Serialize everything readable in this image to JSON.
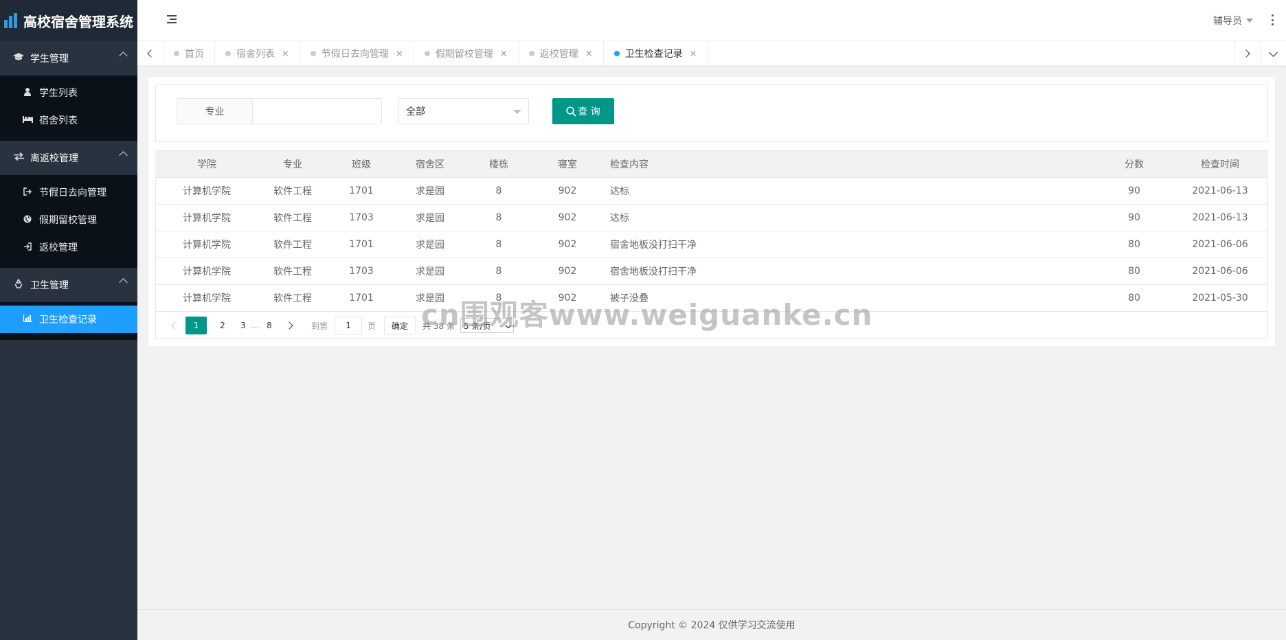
{
  "app": {
    "title": "高校宿舍管理系统"
  },
  "sidebar": {
    "groups": [
      {
        "label": "学生管理",
        "icon": "graduation-cap-icon",
        "items": [
          {
            "label": "学生列表",
            "icon": "user-icon"
          },
          {
            "label": "宿舍列表",
            "icon": "bed-icon"
          }
        ]
      },
      {
        "label": "离返校管理",
        "icon": "exchange-icon",
        "items": [
          {
            "label": "节假日去向管理",
            "icon": "sign-out-icon"
          },
          {
            "label": "假期留校管理",
            "icon": "globe-icon"
          },
          {
            "label": "返校管理",
            "icon": "sign-in-icon"
          }
        ]
      },
      {
        "label": "卫生管理",
        "icon": "recycle-icon",
        "items": [
          {
            "label": "卫生检查记录",
            "icon": "bar-chart-icon",
            "active": true
          }
        ]
      }
    ]
  },
  "header": {
    "user": "辅导员"
  },
  "tabs": [
    {
      "label": "首页",
      "closable": false,
      "active": false
    },
    {
      "label": "宿舍列表",
      "closable": true,
      "active": false
    },
    {
      "label": "节假日去向管理",
      "closable": true,
      "active": false
    },
    {
      "label": "假期留校管理",
      "closable": true,
      "active": false
    },
    {
      "label": "返校管理",
      "closable": true,
      "active": false
    },
    {
      "label": "卫生检查记录",
      "closable": true,
      "active": true
    }
  ],
  "tab_close_glyph": "×",
  "search": {
    "field_label": "专业",
    "field_value": "",
    "select_value": "全部",
    "button_label": "查 询"
  },
  "table": {
    "columns": [
      "学院",
      "专业",
      "班级",
      "宿舍区",
      "楼栋",
      "寝室",
      "检查内容",
      "分数",
      "检查时间"
    ],
    "rows": [
      [
        "计算机学院",
        "软件工程",
        "1701",
        "求是园",
        "8",
        "902",
        "达标",
        "90",
        "2021-06-13"
      ],
      [
        "计算机学院",
        "软件工程",
        "1703",
        "求是园",
        "8",
        "902",
        "达标",
        "90",
        "2021-06-13"
      ],
      [
        "计算机学院",
        "软件工程",
        "1701",
        "求是园",
        "8",
        "902",
        "宿舍地板没打扫干净",
        "80",
        "2021-06-06"
      ],
      [
        "计算机学院",
        "软件工程",
        "1703",
        "求是园",
        "8",
        "902",
        "宿舍地板没打扫干净",
        "80",
        "2021-06-06"
      ],
      [
        "计算机学院",
        "软件工程",
        "1701",
        "求是园",
        "8",
        "902",
        "被子没叠",
        "80",
        "2021-05-30"
      ]
    ]
  },
  "pager": {
    "pages": [
      "1",
      "2",
      "3"
    ],
    "ellipsis": "…",
    "last": "8",
    "current": "1",
    "skip_label": "到第",
    "skip_value": "1",
    "page_unit": "页",
    "confirm": "确定",
    "total": "共 38 条",
    "limit": "5 条/页"
  },
  "watermark": "cn围观客www.weiguanke.cn",
  "footer": {
    "text": "Copyright © 2024 仅供学习交流使用"
  },
  "colors": {
    "sidebar": "#28333f",
    "active": "#1e9fff",
    "primary": "#009688"
  }
}
